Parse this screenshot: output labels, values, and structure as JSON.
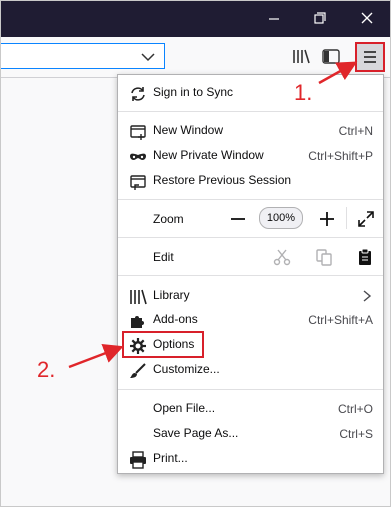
{
  "toolbar": {
    "window_controls": [
      "minimize-icon",
      "restore-icon",
      "close-icon"
    ],
    "url_dropdown_icon": "chevron-down-icon",
    "buttons": [
      "library-icon",
      "sidebar-icon",
      "hamburger-menu-icon"
    ]
  },
  "menu": {
    "sign_in": "Sign in to Sync",
    "new_window": "New Window",
    "new_window_shortcut": "Ctrl+N",
    "new_private_window": "New Private Window",
    "new_private_window_shortcut": "Ctrl+Shift+P",
    "restore_session": "Restore Previous Session",
    "zoom_label": "Zoom",
    "zoom_value": "100%",
    "edit_label": "Edit",
    "library": "Library",
    "addons": "Add-ons",
    "addons_shortcut": "Ctrl+Shift+A",
    "options": "Options",
    "customize": "Customize...",
    "open_file": "Open File...",
    "open_file_shortcut": "Ctrl+O",
    "save_page": "Save Page As...",
    "save_page_shortcut": "Ctrl+S",
    "print": "Print..."
  },
  "annotations": {
    "step1": "1.",
    "step2": "2.",
    "color": "#d8202a"
  }
}
